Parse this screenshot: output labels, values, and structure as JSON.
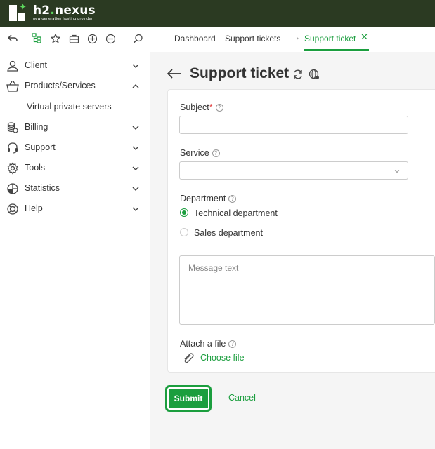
{
  "header": {
    "logo_name_a": "h2",
    "logo_name_dot": ".",
    "logo_name_b": "nexus",
    "logo_tagline": "new generation hosting provider"
  },
  "tabs": [
    {
      "label": "Dashboard"
    },
    {
      "label": "Support tickets"
    },
    {
      "label": "Support ticket",
      "active": true
    }
  ],
  "sidebar": {
    "items": [
      {
        "label": "Client",
        "icon": "user-pin-icon",
        "expanded": false
      },
      {
        "label": "Products/Services",
        "icon": "basket-icon",
        "expanded": true
      },
      {
        "label": "Billing",
        "icon": "coins-icon",
        "expanded": false
      },
      {
        "label": "Support",
        "icon": "headset-icon",
        "expanded": false
      },
      {
        "label": "Tools",
        "icon": "gear-icon",
        "expanded": false
      },
      {
        "label": "Statistics",
        "icon": "pie-chart-icon",
        "expanded": false
      },
      {
        "label": "Help",
        "icon": "lifebuoy-icon",
        "expanded": false
      }
    ],
    "sub_items": [
      {
        "label": "Virtual private servers"
      }
    ]
  },
  "page": {
    "title": "Support ticket"
  },
  "form": {
    "subject_label": "Subject",
    "subject_required_mark": "*",
    "subject_value": "",
    "service_label": "Service",
    "service_value": "",
    "department_label": "Department",
    "departments": [
      {
        "label": "Technical department",
        "checked": true
      },
      {
        "label": "Sales department",
        "checked": false
      }
    ],
    "message_placeholder": "Message text",
    "attach_label": "Attach a file",
    "choose_file_label": "Choose file",
    "help_glyph": "?"
  },
  "actions": {
    "submit_label": "Submit",
    "cancel_label": "Cancel"
  },
  "colors": {
    "header_bg": "#2b3a22",
    "accent": "#1b9e3e",
    "required": "#e03b3b"
  }
}
